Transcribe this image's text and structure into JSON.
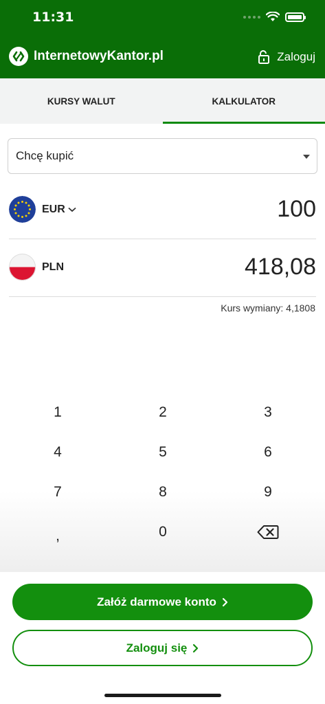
{
  "status_bar": {
    "time": "11:31"
  },
  "header": {
    "brand": "InternetowyKantor.pl",
    "login_label": "Zaloguj"
  },
  "tabs": [
    {
      "label": "KURSY WALUT",
      "active": false
    },
    {
      "label": "KALKULATOR",
      "active": true
    }
  ],
  "calculator": {
    "mode_select": "Chcę kupić",
    "from": {
      "currency": "EUR",
      "amount": "100",
      "flag": "eu-flag-icon"
    },
    "to": {
      "currency": "PLN",
      "amount": "418,08",
      "flag": "pl-flag-icon"
    },
    "rate_text": "Kurs wymiany: 4,1808"
  },
  "keypad": {
    "keys": [
      "1",
      "2",
      "3",
      "4",
      "5",
      "6",
      "7",
      "8",
      "9",
      ",",
      "0"
    ]
  },
  "actions": {
    "register_label": "Załóż darmowe konto",
    "login_label": "Zaloguj się"
  },
  "colors": {
    "brand_green": "#0a6e07",
    "accent_green": "#138f0e"
  }
}
